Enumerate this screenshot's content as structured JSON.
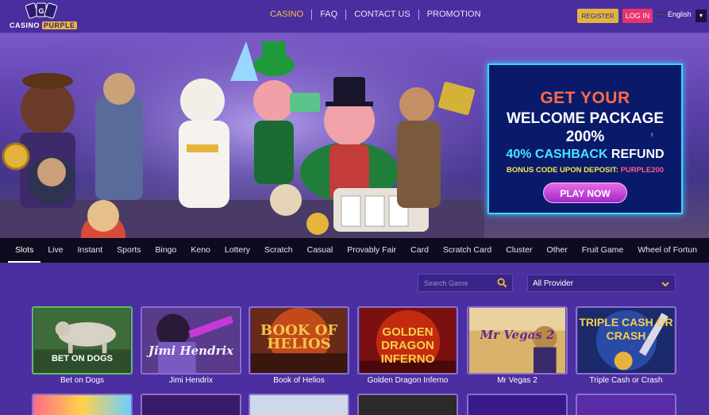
{
  "logo": {
    "text_top": "CASINO",
    "text_bottom": "PURPLE"
  },
  "nav": {
    "items": [
      "CASINO",
      "FAQ",
      "CONTACT US",
      "PROMOTION"
    ]
  },
  "header": {
    "register_label": "REGISTER",
    "login_label": "LOG IN",
    "language": "English",
    "language_caret": "▾"
  },
  "promo": {
    "line1": "GET YOUR",
    "line2": "WELCOME PACKAGE",
    "line3": "200%",
    "line4a": "40% CASHBACK",
    "line4b": " REFUND",
    "line5a": "BONUS CODE UPON DEPOSIT: ",
    "line5b": "PURPLE200",
    "cta": "PLAY NOW",
    "next_arrow": "›"
  },
  "categories": [
    "Slots",
    "Live",
    "Instant",
    "Sports",
    "Bingo",
    "Keno",
    "Lottery",
    "Scratch",
    "Casual",
    "Provably Fair",
    "Card",
    "Scratch Card",
    "Cluster",
    "Other",
    "Fruit Game",
    "Wheel of Fortun"
  ],
  "filters": {
    "search_placeholder": "Search Game",
    "provider_value": "All Provider"
  },
  "games": [
    {
      "name": "Bet on Dogs",
      "art_title": "BET ON DOGS"
    },
    {
      "name": "Jimi Hendrix",
      "art_title": "Jimi Hendrix"
    },
    {
      "name": "Book of Helios",
      "art_title": "BOOK OF HELIOS"
    },
    {
      "name": "Golden Dragon Inferno",
      "art_title": "GOLDEN DRAGON INFERNO"
    },
    {
      "name": "Mr Vegas 2",
      "art_title": "Mr Vegas 2"
    },
    {
      "name": "Triple Cash or Crash",
      "art_title": "TRIPLE CASH OR CRASH"
    }
  ],
  "colors": {
    "accent": "#f4c24e",
    "register": "#e0b53f",
    "login": "#e8346d",
    "background": "#4b2fa0",
    "category_bar": "#0f0b1f"
  }
}
